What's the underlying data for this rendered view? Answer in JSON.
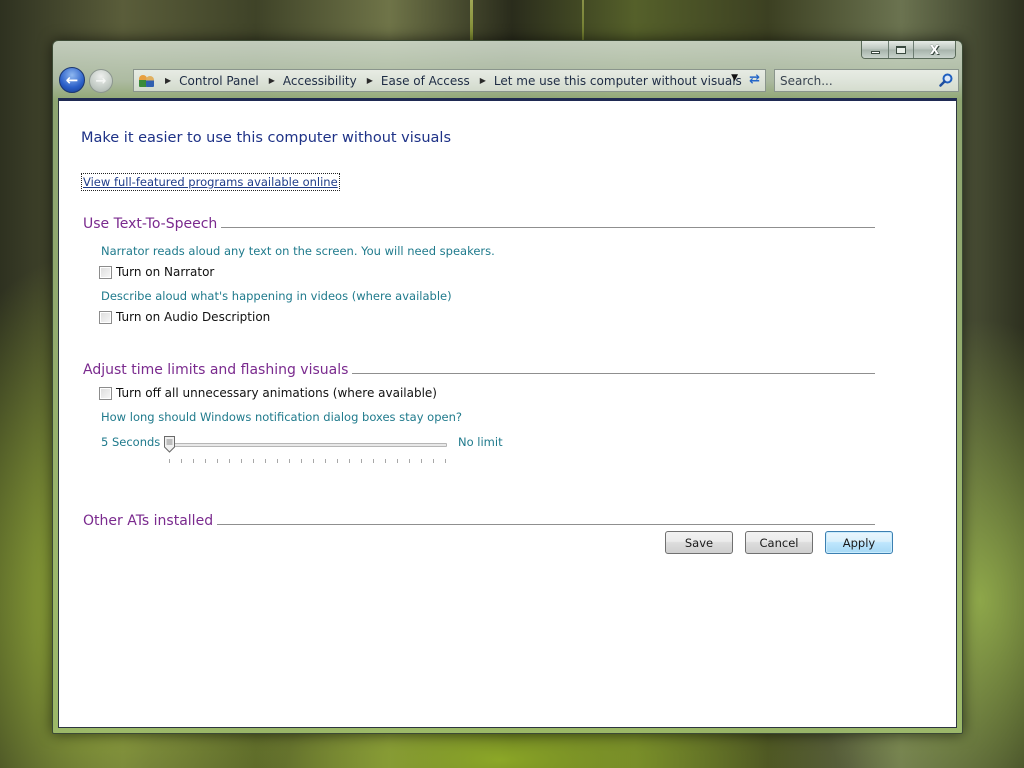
{
  "window": {
    "caption_buttons": {
      "minimize": "minimize",
      "maximize": "maximize",
      "close": "X"
    }
  },
  "navigation": {
    "back_glyph": "←",
    "forward_glyph": "→",
    "breadcrumb": [
      "Control Panel",
      "Accessibility",
      "Ease of Access",
      "Let me use this computer without visuals"
    ],
    "crumb_separator": "▶",
    "dropdown_glyph": "▼",
    "refresh_glyph": "⇄",
    "search_placeholder": "Search..."
  },
  "page": {
    "title": "Make it easier to use this computer without visuals",
    "online_link": "View full-featured programs available online",
    "sections": [
      {
        "title": "Use Text-To-Speech",
        "items": [
          {
            "description": "Narrator reads aloud any text on the screen. You will need speakers.",
            "checkbox_label": "Turn on Narrator",
            "checked": false
          },
          {
            "description": "Describe aloud what's happening in videos (where available)",
            "checkbox_label": "Turn on Audio Description",
            "checked": false
          }
        ]
      },
      {
        "title": "Adjust time limits and flashing visuals",
        "animations_checkbox": {
          "label": "Turn off all unnecessary animations (where available)",
          "checked": false
        },
        "slider_question": "How long should Windows notification dialog boxes stay open?",
        "slider_min_label": "5 Seconds",
        "slider_max_label": "No limit",
        "slider_value_fraction": 0.0,
        "slider_tick_count": 24
      },
      {
        "title": "Other ATs installed"
      }
    ]
  },
  "buttons": {
    "save": "Save",
    "cancel": "Cancel",
    "apply": "Apply"
  }
}
